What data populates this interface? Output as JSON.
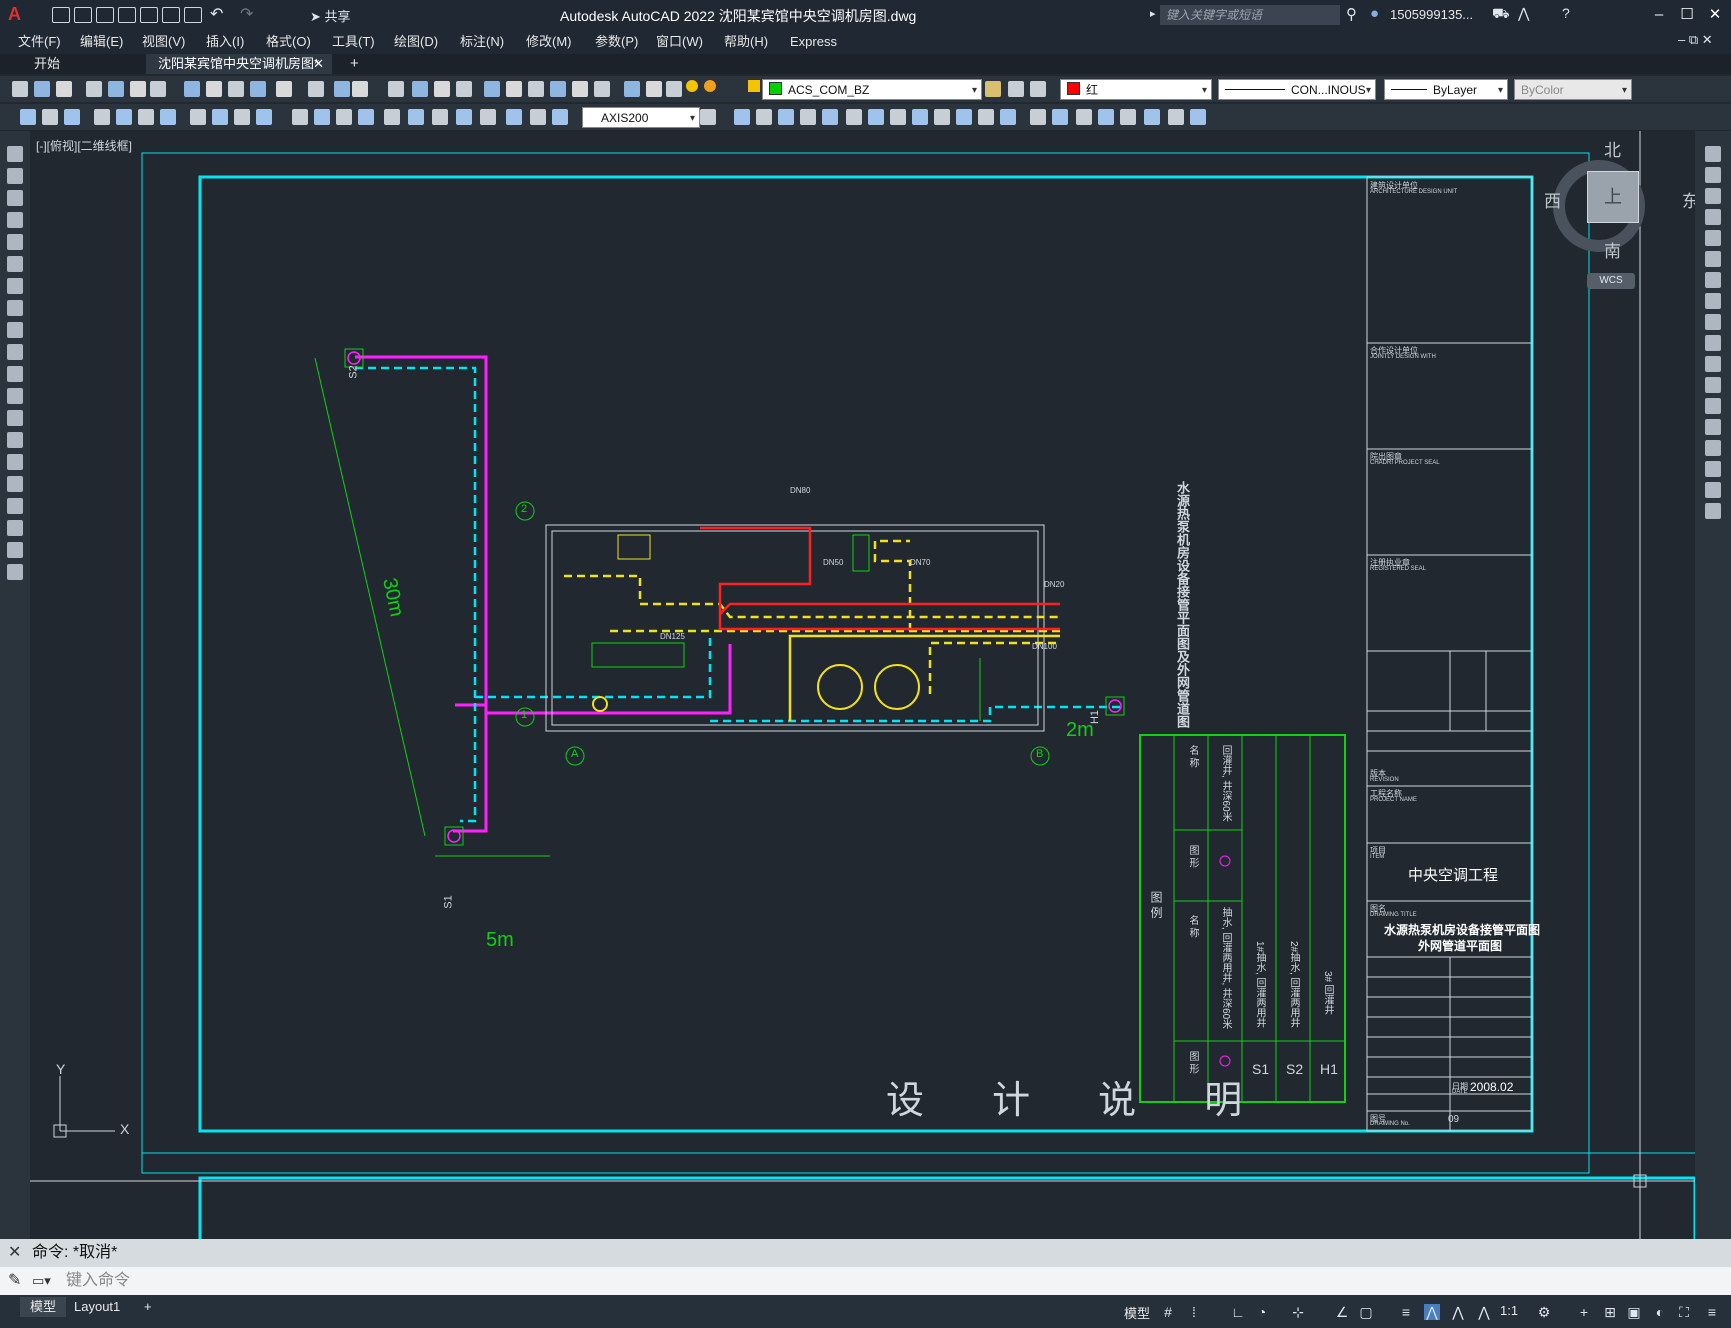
{
  "app": {
    "title": "Autodesk AutoCAD 2022    沈阳某宾馆中央空调机房图.dwg",
    "share_label": "共享",
    "search_placeholder": "键入关键字或短语",
    "user": "1505999135...",
    "logo": "A"
  },
  "menu": [
    "文件(F)",
    "编辑(E)",
    "视图(V)",
    "插入(I)",
    "格式(O)",
    "工具(T)",
    "绘图(D)",
    "标注(N)",
    "修改(M)",
    "参数(P)",
    "窗口(W)",
    "帮助(H)",
    "Express"
  ],
  "tabs": {
    "start": "开始",
    "active": "沈阳某宾馆中央空调机房图*",
    "add": "+"
  },
  "properties": {
    "layer": "ACS_COM_BZ",
    "color": "红",
    "linetype": "CON...INOUS",
    "lineweight": "ByLayer",
    "plotstyle": "ByColor",
    "dimstyle": "AXIS200"
  },
  "viewport_label": "[-][俯视][二维线框]",
  "viewcube": {
    "north": "北",
    "south": "南",
    "east": "东",
    "west": "西",
    "face": "上",
    "wcs": "WCS"
  },
  "ucs": {
    "x": "X",
    "y": "Y"
  },
  "drawing": {
    "dims": {
      "d30m": "30m",
      "d5m": "5m",
      "d2m": "2m"
    },
    "wells": [
      "S1",
      "S2",
      "H1"
    ],
    "axes": [
      "A",
      "B",
      "1",
      "2"
    ],
    "pipes": [
      "DN100",
      "DN125",
      "DN80",
      "DN50",
      "DN70",
      "DN20"
    ],
    "vertical_title": "水源热泵机房设备接管平面图及外网管道图",
    "bottom_title": "设 计 说 明",
    "legend": {
      "header": "图 例",
      "col_symbol": "图 形",
      "col_name": "名 称",
      "rows": [
        {
          "code": "H1",
          "name": "3# 回灌井"
        },
        {
          "code": "S2",
          "name": "2#抽水, 回灌两用井"
        },
        {
          "code": "S1",
          "name": "1#抽水, 回灌两用井"
        },
        {
          "code": "⊗",
          "name": "抽水, 回灌两用井, 井深60米"
        },
        {
          "code": "○",
          "name": "回灌井, 井深60米"
        }
      ]
    },
    "titleblock": {
      "arch_unit": "建筑设计单位",
      "arch_unit_en": "ARCHITECTURE DESIGN UNIT",
      "joint": "合作设计单位",
      "joint_en": "JOINTLY DESIGN WITH",
      "seal": "院出图章",
      "seal_en": "CHADRI PROJECT SEAL",
      "reg": "注册执业章",
      "reg_en": "REGISTERED SEAL",
      "rev": "版本",
      "rev_en": "REVISION",
      "project_name": "工程名称",
      "project_name_en": "PROJECT NAME",
      "item": "项目",
      "item_en": "ITEM",
      "item_value": "中央空调工程",
      "drawing_title": "图名",
      "drawing_title_en": "DRAWING TITLE",
      "title_line1": "水源热泵机房设备接管平面图",
      "title_line2": "外网管道平面图",
      "date_label": "日期",
      "date_en": "DATE",
      "date_value": "2008.02",
      "drawing_no_label": "图号",
      "drawing_no_en": "DRAWING No.",
      "drawing_no": "09"
    }
  },
  "command": {
    "history": "命令: *取消*",
    "input_placeholder": "键入命令"
  },
  "status": {
    "model_tab": "模型",
    "layout_tab": "Layout1",
    "add": "+",
    "model_btn": "模型",
    "scale": "1:1"
  }
}
